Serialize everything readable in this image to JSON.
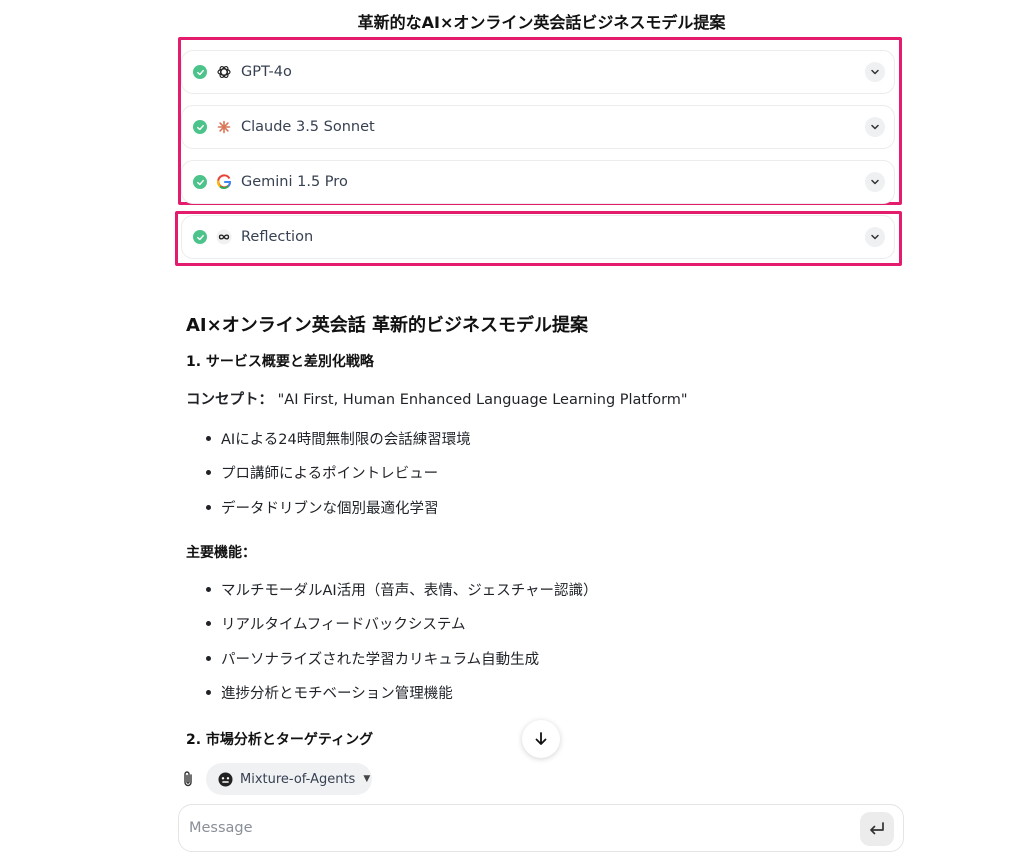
{
  "chat": {
    "title": "革新的なAI×オンライン英会話ビジネスモデル提案"
  },
  "models": [
    {
      "name": "GPT-4o",
      "icon": "openai-icon",
      "status": "done"
    },
    {
      "name": "Claude 3.5 Sonnet",
      "icon": "claude-icon",
      "status": "done"
    },
    {
      "name": "Gemini 1.5 Pro",
      "icon": "google-icon",
      "status": "done"
    },
    {
      "name": "Reflection",
      "icon": "infinity-icon",
      "status": "done"
    }
  ],
  "response": {
    "heading": "AI×オンライン英会話 革新的ビジネスモデル提案",
    "section1_title": "1. サービス概要と差別化戦略",
    "concept_label": "コンセプト：",
    "concept_value": "\"AI First, Human Enhanced Language Learning Platform\"",
    "concept_bullets": [
      "AIによる24時間無制限の会話練習環境",
      "プロ講師によるポイントレビュー",
      "データドリブンな個別最適化学習"
    ],
    "features_title": "主要機能：",
    "features_bullets": [
      "マルチモーダルAI活用（音声、表情、ジェスチャー認識）",
      "リアルタイムフィードバックシステム",
      "パーソナライズされた学習カリキュラム自動生成",
      "進捗分析とモチベーション管理機能"
    ],
    "section2_title": "2. 市場分析とターゲティング"
  },
  "composer": {
    "agent_label": "Mixture-of-Agents",
    "message_placeholder": "Message"
  },
  "colors": {
    "highlight": "#e31c6e",
    "check": "#4cc38a",
    "claude": "#d97757"
  }
}
